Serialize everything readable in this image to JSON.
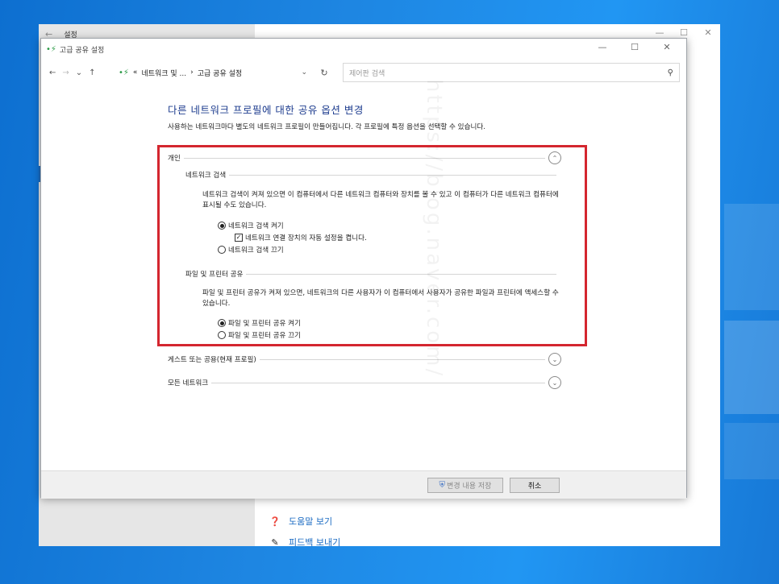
{
  "settings": {
    "title": "설정",
    "back_glyph": "←",
    "controls": [
      "—",
      "☐",
      "✕"
    ],
    "help": [
      {
        "icon": "help-icon",
        "glyph": "❓",
        "label": "도움말 보기"
      },
      {
        "icon": "feedback-icon",
        "glyph": "✎",
        "label": "피드백 보내기"
      }
    ]
  },
  "window": {
    "title": "고급 공유 설정",
    "app_icon_glyph": "•⚡",
    "controls": [
      "—",
      "☐",
      "✕"
    ]
  },
  "nav": {
    "back": "←",
    "forward": "→",
    "recent": "⌄",
    "up": "↑"
  },
  "address": {
    "prefix": "«",
    "crumb1": "네트워크 및 ...",
    "sep": "›",
    "crumb2": "고급 공유 설정",
    "chevron": "⌄",
    "refresh": "↻"
  },
  "search": {
    "placeholder": "제어판 검색",
    "icon_glyph": "⚲"
  },
  "content": {
    "title": "다른 네트워크 프로필에 대한 공유 옵션 변경",
    "desc": "사용하는 네트워크마다 별도의 네트워크 프로필이 만들어집니다. 각 프로필에 특정 옵션을 선택할 수 있습니다."
  },
  "private": {
    "label": "개인",
    "toggle_glyph": "⌃",
    "discovery": {
      "heading": "네트워크 검색",
      "desc": "네트워크 검색이 켜져 있으면 이 컴퓨터에서 다른 네트워크 컴퓨터와 장치를 볼 수 있고 이 컴퓨터가 다른 네트워크 컴퓨터에 표시될 수도 있습니다.",
      "on_label": "네트워크 검색 켜기",
      "auto_label": "네트워크 연결 장치의 자동 설정을 켭니다.",
      "off_label": "네트워크 검색 끄기",
      "check_glyph": "✓"
    },
    "sharing": {
      "heading": "파일 및 프린터 공유",
      "desc": "파일 및 프린터 공유가 켜져 있으면, 네트워크의 다른 사용자가 이 컴퓨터에서 사용자가 공유한 파일과 프린터에 액세스할 수 있습니다.",
      "on_label": "파일 및 프린터 공유 켜기",
      "off_label": "파일 및 프린터 공유 끄기"
    }
  },
  "guest": {
    "label": "게스트 또는 공용(현재 프로필)",
    "toggle_glyph": "⌄"
  },
  "all": {
    "label": "모든 네트워크",
    "toggle_glyph": "⌄"
  },
  "footer": {
    "save_label": "변경 내용 저장",
    "shield_glyph": "⛨",
    "cancel_label": "취소"
  },
  "watermark": "https://blog.naver.com/"
}
